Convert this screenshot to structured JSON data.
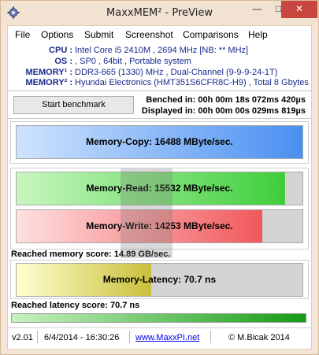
{
  "window": {
    "title": "MaxxMEM² - PreView",
    "minimize_label": "—",
    "maximize_label": "□",
    "close_label": "✕"
  },
  "menu": [
    {
      "label": "File"
    },
    {
      "label": "Options"
    },
    {
      "label": "Submit"
    },
    {
      "label": "Screenshot"
    },
    {
      "label": "Comparisons"
    },
    {
      "label": "Help"
    }
  ],
  "system_info": {
    "cpu_label": "CPU :",
    "cpu_value": "Intel Core i5 2410M , 2694 MHz [NB: ** MHz]",
    "os_label": "OS :",
    "os_value": ", SP0 , 64bit , Portable system",
    "memory1_label": "MEMORY¹ :",
    "memory1_value": "DDR3-665 (1330) MHz , Dual-Channel (9-9-9-24-1T)",
    "memory2_label": "MEMORY² :",
    "memory2_value": "Hyundai Electronics (HMT351S6CFR8C-H9) , Total 8 Gbytes"
  },
  "benchmark": {
    "start_label": "Start benchmark",
    "benched_label": "Benched in: 00h 00m 18s 072ms 420µs",
    "displayed_label": "Displayed in: 00h 00m 00s 029ms 819µs"
  },
  "results": {
    "copy": {
      "label": "Memory-Copy: 16488 MByte/sec.",
      "fraction": 1.0,
      "color_start": "#cfe3ff",
      "color_end": "#4a90f0"
    },
    "read": {
      "label": "Memory-Read: 15532 MByte/sec.",
      "fraction": 0.94,
      "color_start": "#c8f7c0",
      "color_end": "#3fce3a"
    },
    "write": {
      "label": "Memory-Write: 14253 MByte/sec.",
      "fraction": 0.86,
      "color_start": "#ffe0e0",
      "color_end": "#f0585b"
    },
    "memory_score": "Reached memory score: 14.89 GB/sec.",
    "latency": {
      "label": "Memory-Latency: 70.7 ns",
      "fraction": 0.47,
      "color_start": "#ffffd0",
      "color_end": "#c9bf3c"
    },
    "latency_score": "Reached latency score: 70.7 ns",
    "progress_fraction": 1.0,
    "progress_color_start": "#c8f2c0",
    "progress_color_end": "#169b14"
  },
  "status": {
    "version": "v2.01",
    "datetime": "6/4/2014 - 16:30:26",
    "website": "www.MaxxPI.net",
    "copyright": "© M.Bicak 2014"
  }
}
